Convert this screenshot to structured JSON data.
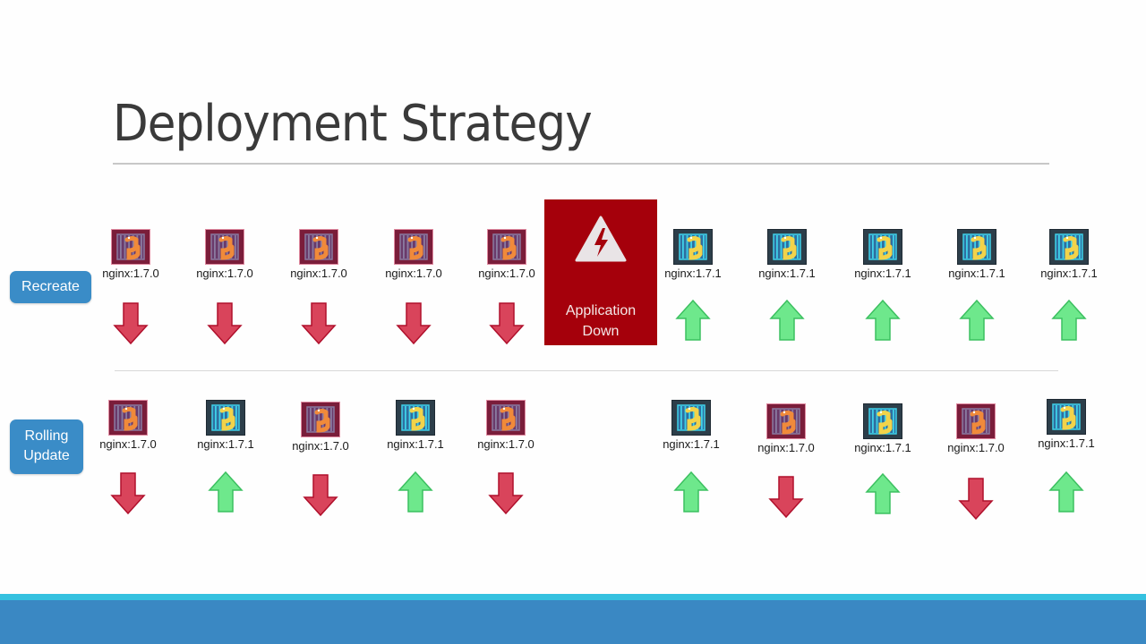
{
  "slide": {
    "title": "Deployment Strategy",
    "colors": {
      "accent_blue": "#3a8cc7",
      "footer_blue": "#3a88c3",
      "footer_cyan": "#35c1e0",
      "down_red": "#a5000b",
      "arrow_down": "#d9445b",
      "arrow_up": "#6ee88c",
      "old_pod": "#7a1d3a",
      "new_pod": "#2c3e4a"
    }
  },
  "recreate": {
    "label": "Recreate",
    "old_pods": [
      {
        "name": "nginx:1.7.0",
        "version": "old",
        "arrow": "down"
      },
      {
        "name": "nginx:1.7.0",
        "version": "old",
        "arrow": "down"
      },
      {
        "name": "nginx:1.7.0",
        "version": "old",
        "arrow": "down"
      },
      {
        "name": "nginx:1.7.0",
        "version": "old",
        "arrow": "down"
      },
      {
        "name": "nginx:1.7.0",
        "version": "old",
        "arrow": "down"
      }
    ],
    "status_box": {
      "line1": "Application",
      "line2": "Down",
      "icon": "warning-lightning-icon"
    },
    "new_pods": [
      {
        "name": "nginx:1.7.1",
        "version": "new",
        "arrow": "up"
      },
      {
        "name": "nginx:1.7.1",
        "version": "new",
        "arrow": "up"
      },
      {
        "name": "nginx:1.7.1",
        "version": "new",
        "arrow": "up"
      },
      {
        "name": "nginx:1.7.1",
        "version": "new",
        "arrow": "up"
      },
      {
        "name": "nginx:1.7.1",
        "version": "new",
        "arrow": "up"
      }
    ]
  },
  "rolling": {
    "label_line1": "Rolling",
    "label_line2": "Update",
    "pods": [
      {
        "name": "nginx:1.7.0",
        "version": "old",
        "arrow": "down"
      },
      {
        "name": "nginx:1.7.1",
        "version": "new",
        "arrow": "up"
      },
      {
        "name": "nginx:1.7.0",
        "version": "old",
        "arrow": "down"
      },
      {
        "name": "nginx:1.7.1",
        "version": "new",
        "arrow": "up"
      },
      {
        "name": "nginx:1.7.0",
        "version": "old",
        "arrow": "down"
      },
      {
        "name": "nginx:1.7.1",
        "version": "new",
        "arrow": "up"
      },
      {
        "name": "nginx:1.7.0",
        "version": "old",
        "arrow": "down"
      },
      {
        "name": "nginx:1.7.1",
        "version": "new",
        "arrow": "up"
      },
      {
        "name": "nginx:1.7.0",
        "version": "old",
        "arrow": "down"
      },
      {
        "name": "nginx:1.7.1",
        "version": "new",
        "arrow": "up"
      }
    ]
  }
}
